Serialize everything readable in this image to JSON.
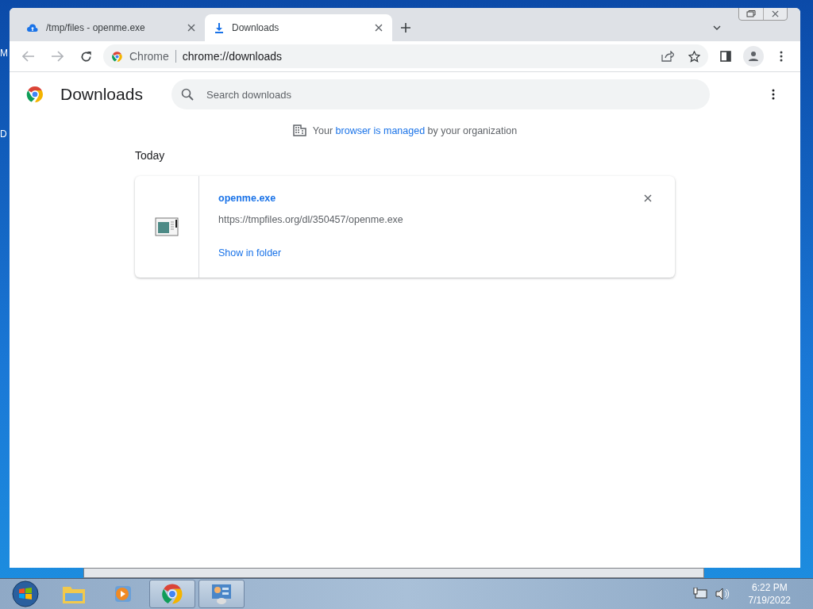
{
  "desktop": {
    "fragments": [
      "M",
      "D"
    ]
  },
  "window": {
    "tabs": [
      {
        "title": "/tmp/files - openme.exe",
        "kind": "upload",
        "selected": false
      },
      {
        "title": "Downloads",
        "kind": "download",
        "selected": true
      }
    ],
    "omnibox": {
      "chip": "Chrome",
      "url": "chrome://downloads"
    }
  },
  "page": {
    "title": "Downloads",
    "search": {
      "placeholder": "Search downloads"
    },
    "managed_notice": {
      "before": "Your ",
      "link": "browser is managed",
      "after": " by your organization"
    },
    "section": "Today",
    "downloads": [
      {
        "name": "openme.exe",
        "url": "https://tmpfiles.org/dl/350457/openme.exe",
        "action": "Show in folder"
      }
    ]
  },
  "taskbar": {
    "apps": [
      {
        "kind": "explorer",
        "open": false
      },
      {
        "kind": "media",
        "open": false
      },
      {
        "kind": "chrome",
        "open": true
      },
      {
        "kind": "control",
        "open": true
      }
    ],
    "time": "6:22 PM",
    "date": "7/19/2022"
  }
}
